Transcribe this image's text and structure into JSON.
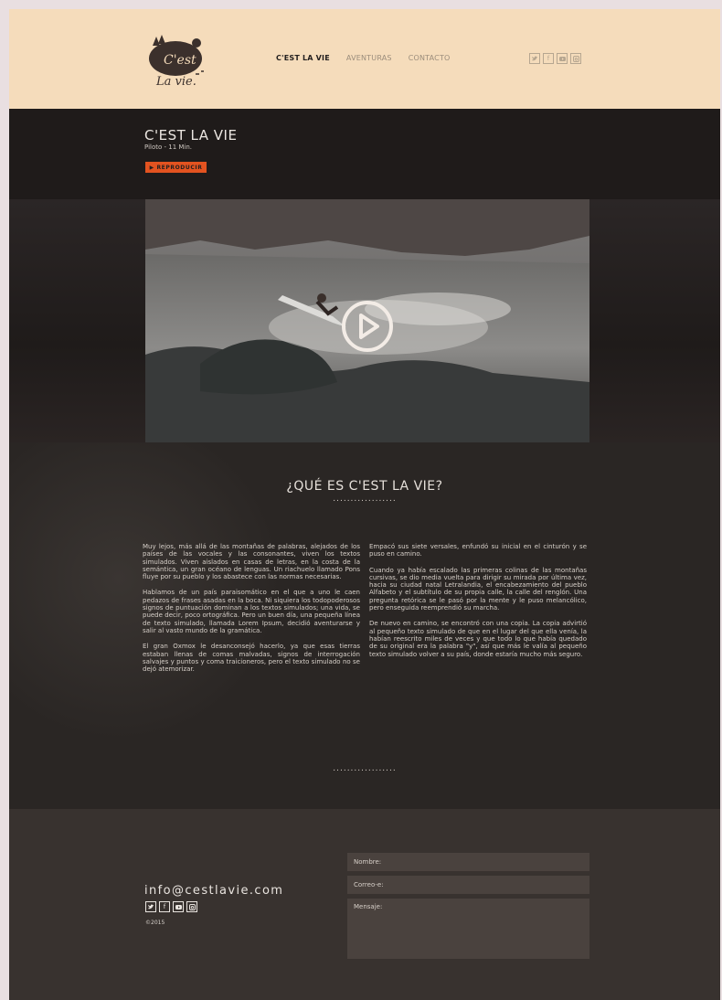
{
  "brand": {
    "logo_line1": "C'est",
    "logo_line2": "La vie."
  },
  "nav": {
    "items": [
      "C'EST LA VIE",
      "AVENTURAS",
      "CONTACTO"
    ]
  },
  "social_icons": [
    "twitter-icon",
    "facebook-icon",
    "youtube-icon",
    "instagram-icon"
  ],
  "hero": {
    "title": "C'EST LA VIE",
    "subtitle": "Piloto - 11 Min.",
    "button_label": "▶ REPRODUCIR"
  },
  "about": {
    "title": "¿QUÉ ES C'EST LA VIE?",
    "divider": "..................",
    "left_paragraphs": [
      "Muy lejos, más allá de las montañas de palabras, alejados de los países de las vocales y las consonantes, viven los textos simulados. Viven aislados en casas de letras, en la costa de la semántica, un gran océano de lenguas. Un riachuelo llamado Pons fluye por su pueblo y los abastece con las normas necesarias.",
      "Hablamos de un país paraisomático en el que a uno le caen pedazos de frases asadas en la boca. Ni siquiera los todopoderosos signos de puntuación dominan a los textos simulados; una vida, se puede decir, poco ortográfica. Pero un buen día, una pequeña línea de texto simulado, llamada Lorem Ipsum, decidió aventurarse y salir al vasto mundo de la gramática.",
      "El gran Oxmox le desanconsejó hacerlo, ya que esas tierras estaban llenas de comas malvadas, signos de interrogación salvajes y puntos y coma traicioneros, pero el texto simulado no se dejó atemorizar."
    ],
    "right_paragraphs": [
      "Empacó sus siete versales, enfundó su inicial en el cinturón y se puso en camino.",
      "Cuando ya había escalado las primeras colinas de las montañas cursivas, se dio media vuelta para dirigir su mirada por última vez, hacia su ciudad natal Letralandia, el encabezamiento del pueblo Alfabeto y el subtítulo de su propia calle, la calle del renglón. Una pregunta retórica se le pasó por la mente y le puso melancólico, pero enseguida reemprendió su marcha.",
      "De nuevo en camino, se encontró con una copia. La copia advirtió al pequeño texto simulado de que en el lugar del que ella venía, la habían reescrito miles de veces y que todo lo que había quedado de su original era la palabra \"y\", así que más le valía al pequeño texto simulado volver a su país, donde estaría mucho más seguro."
    ]
  },
  "footer": {
    "email": "info@cestlavie.com",
    "copyright": "©2015",
    "form": {
      "name_placeholder": "Nombre:",
      "email_placeholder": "Correo-e:",
      "message_placeholder": "Mensaje:"
    }
  },
  "colors": {
    "header_bg": "#f5dcbb",
    "dark_bg": "#231f1e",
    "accent": "#e35320",
    "footer_bg": "#38322f"
  }
}
